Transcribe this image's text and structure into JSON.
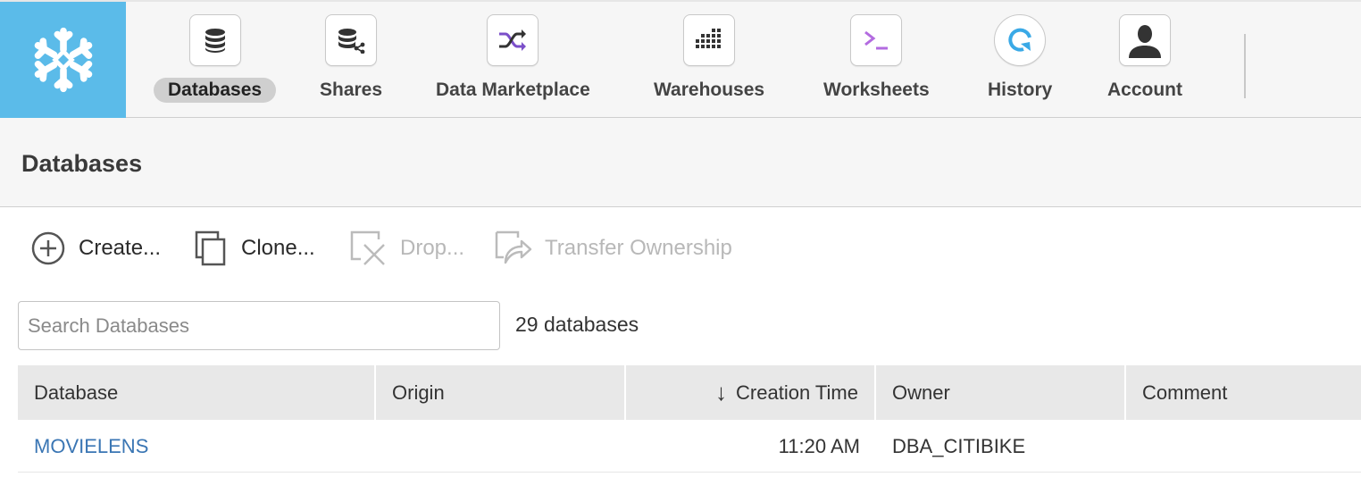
{
  "nav": {
    "items": [
      {
        "label": "Databases",
        "icon": "database-icon",
        "active": true
      },
      {
        "label": "Shares",
        "icon": "share-database-icon",
        "active": false
      },
      {
        "label": "Data Marketplace",
        "icon": "shuffle-icon",
        "active": false
      },
      {
        "label": "Warehouses",
        "icon": "grid-dots-icon",
        "active": false
      },
      {
        "label": "Worksheets",
        "icon": "terminal-prompt-icon",
        "active": false
      },
      {
        "label": "History",
        "icon": "history-refresh-icon",
        "active": false
      },
      {
        "label": "Account",
        "icon": "user-silhouette-icon",
        "active": false
      }
    ]
  },
  "colors": {
    "brand": "#5bbbe9",
    "link": "#3a76b4",
    "marketplace_accent": "#7b4fc9",
    "worksheet_accent": "#b36be0",
    "history_accent": "#3aa9e6"
  },
  "page": {
    "title": "Databases"
  },
  "toolbar": {
    "create_label": "Create...",
    "clone_label": "Clone...",
    "drop_label": "Drop...",
    "transfer_label": "Transfer Ownership"
  },
  "search": {
    "placeholder": "Search Databases",
    "value": ""
  },
  "count_text": "29 databases",
  "table": {
    "columns": [
      {
        "label": "Database"
      },
      {
        "label": "Origin"
      },
      {
        "label": "Creation Time",
        "sort_arrow": "↓"
      },
      {
        "label": "Owner"
      },
      {
        "label": "Comment"
      }
    ],
    "rows": [
      {
        "database": "MOVIELENS",
        "origin": "",
        "creation_time": "11:20 AM",
        "owner": "DBA_CITIBIKE",
        "comment": ""
      }
    ]
  }
}
